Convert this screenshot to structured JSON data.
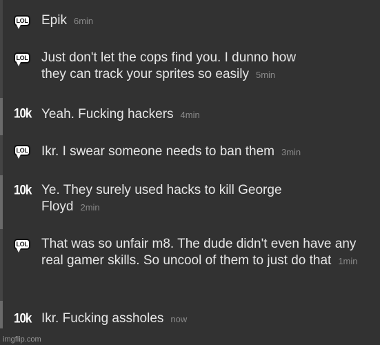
{
  "messages": [
    {
      "user_icon": "lol-speech-bubble-icon",
      "icon_text": "LOL",
      "text": "Epik",
      "time": "6min"
    },
    {
      "user_icon": "lol-speech-bubble-icon",
      "icon_text": "LOL",
      "text": "Just don't let the cops find you. I dunno how they can track your sprites so easily",
      "time": "5min"
    },
    {
      "user_icon": "10k-badge-icon",
      "icon_text": "10k",
      "text": "Yeah. Fucking hackers",
      "time": "4min"
    },
    {
      "user_icon": "lol-speech-bubble-icon",
      "icon_text": "LOL",
      "text": "Ikr. I swear someone needs to ban them",
      "time": "3min"
    },
    {
      "user_icon": "10k-badge-icon",
      "icon_text": "10k",
      "text": "Ye. They surely used hacks to kill George Floyd",
      "time": "2min"
    },
    {
      "user_icon": "lol-speech-bubble-icon",
      "icon_text": "LOL",
      "text": "That was so unfair m8. The dude didn't even have any real gamer skills. So uncool of them to just do that",
      "time": "1min"
    },
    {
      "user_icon": "10k-badge-icon",
      "icon_text": "10k",
      "text": "Ikr. Fucking assholes",
      "time": "now"
    }
  ],
  "watermark": "imgflip.com"
}
